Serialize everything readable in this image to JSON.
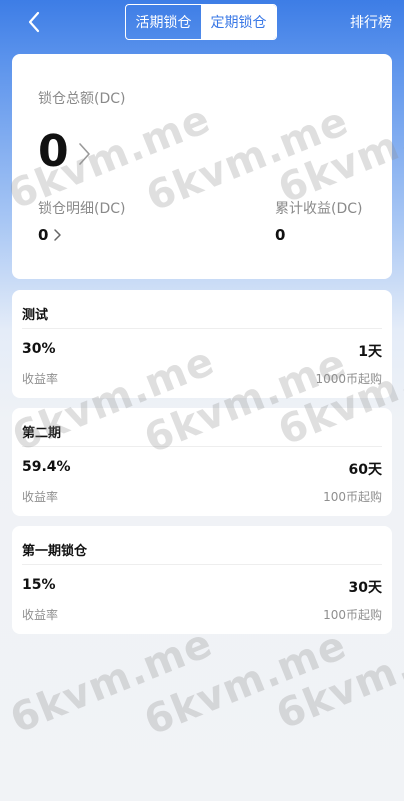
{
  "header": {
    "tabs": [
      {
        "label": "活期锁仓",
        "active": false
      },
      {
        "label": "定期锁仓",
        "active": true
      }
    ],
    "ranking_label": "排行榜",
    "back_icon": "chevron-left-icon"
  },
  "summary": {
    "total_label": "锁仓总额(DC)",
    "total_value": "0",
    "detail_label": "锁仓明细(DC)",
    "detail_value": "0",
    "income_label": "累计收益(DC)",
    "income_value": "0"
  },
  "products": [
    {
      "title": "测试",
      "rate": "30%",
      "days": "1天",
      "rate_label": "收益率",
      "min": "1000币起购"
    },
    {
      "title": "第二期",
      "rate": "59.4%",
      "days": "60天",
      "rate_label": "收益率",
      "min": "100币起购"
    },
    {
      "title": "第一期锁仓",
      "rate": "15%",
      "days": "30天",
      "rate_label": "收益率",
      "min": "100币起购"
    }
  ],
  "watermark": "6kvm.me",
  "colors": {
    "accent": "#3a78e6",
    "header_bg": "#3d7de6",
    "page_bg": "#f1f3f6"
  }
}
